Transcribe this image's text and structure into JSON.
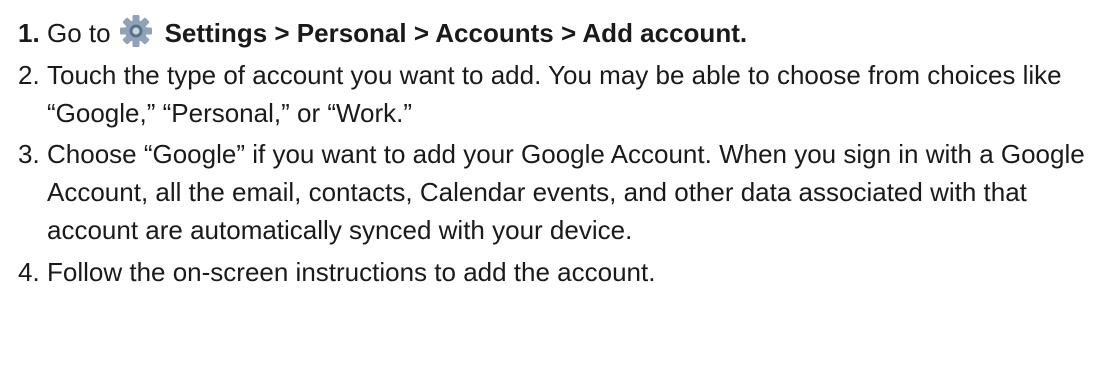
{
  "steps": [
    {
      "number": "1.",
      "prefix": "Go to",
      "icon": "settings-gear-icon",
      "path": "Settings > Personal > Accounts > Add account."
    },
    {
      "number": "2.",
      "text": "Touch the type of account you want to add. You may be able to choose from choices like “Google,” “Personal,” or “Work.”"
    },
    {
      "number": "3.",
      "text": "Choose “Google” if you want to add your Google Account. When you sign in with a Google Account, all the email, contacts, Calendar events, and other data associated with that account are automatically synced with your device."
    },
    {
      "number": "4.",
      "text": "Follow the on-screen instructions to add the account."
    }
  ],
  "colors": {
    "text": "#1a1a1a",
    "icon_gear": "#8fa3b8",
    "icon_center": "#5d7185"
  }
}
